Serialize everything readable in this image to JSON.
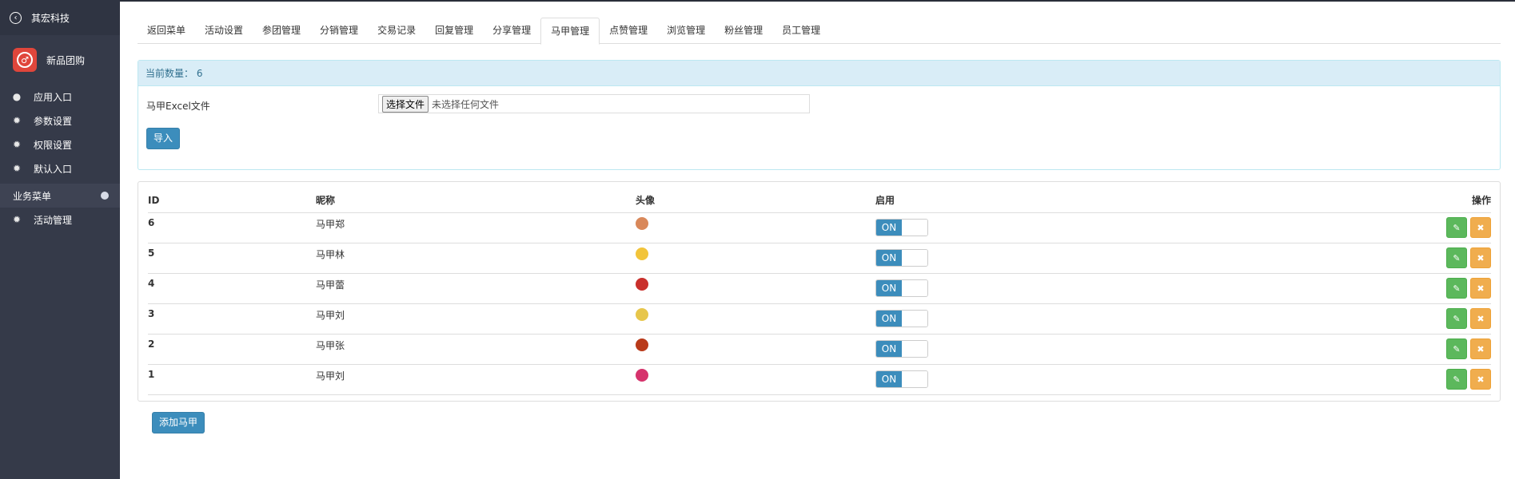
{
  "sidebar": {
    "company": "其宏科技",
    "app_name": "新品团购",
    "items": [
      {
        "label": "应用入口",
        "icon": "chat-bubble-icon"
      },
      {
        "label": "参数设置",
        "icon": "gear-icon"
      },
      {
        "label": "权限设置",
        "icon": "gear-icon"
      },
      {
        "label": "默认入口",
        "icon": "gear-icon"
      }
    ],
    "section_label": "业务菜单",
    "section_items": [
      {
        "label": "活动管理",
        "icon": "gear-icon"
      }
    ]
  },
  "tabs": [
    "返回菜单",
    "活动设置",
    "参团管理",
    "分销管理",
    "交易记录",
    "回复管理",
    "分享管理",
    "马甲管理",
    "点赞管理",
    "浏览管理",
    "粉丝管理",
    "员工管理"
  ],
  "active_tab": "马甲管理",
  "import_panel": {
    "count_label": "当前数量：",
    "count_value": "6",
    "file_label": "马甲Excel文件",
    "choose_file": "选择文件",
    "no_file": "未选择任何文件",
    "import_button": "导入"
  },
  "table": {
    "headers": {
      "id": "ID",
      "nickname": "昵称",
      "avatar": "头像",
      "enabled": "启用",
      "actions": "操作"
    },
    "rows": [
      {
        "id": "6",
        "nickname": "马甲郑",
        "enabled": "ON",
        "avatar_color": "#d9885a"
      },
      {
        "id": "5",
        "nickname": "马甲林",
        "enabled": "ON",
        "avatar_color": "#f2c43a"
      },
      {
        "id": "4",
        "nickname": "马甲蕾",
        "enabled": "ON",
        "avatar_color": "#c9302c"
      },
      {
        "id": "3",
        "nickname": "马甲刘",
        "enabled": "ON",
        "avatar_color": "#e7c64b"
      },
      {
        "id": "2",
        "nickname": "马甲张",
        "enabled": "ON",
        "avatar_color": "#b93a1a"
      },
      {
        "id": "1",
        "nickname": "马甲刘",
        "enabled": "ON",
        "avatar_color": "#d6336c"
      }
    ]
  },
  "add_button": "添加马甲",
  "colors": {
    "sidebar_bg": "#353a49",
    "primary": "#3c8dbc",
    "success": "#5cb85c",
    "warning": "#f0ad4e",
    "info_bg": "#d9edf7"
  }
}
